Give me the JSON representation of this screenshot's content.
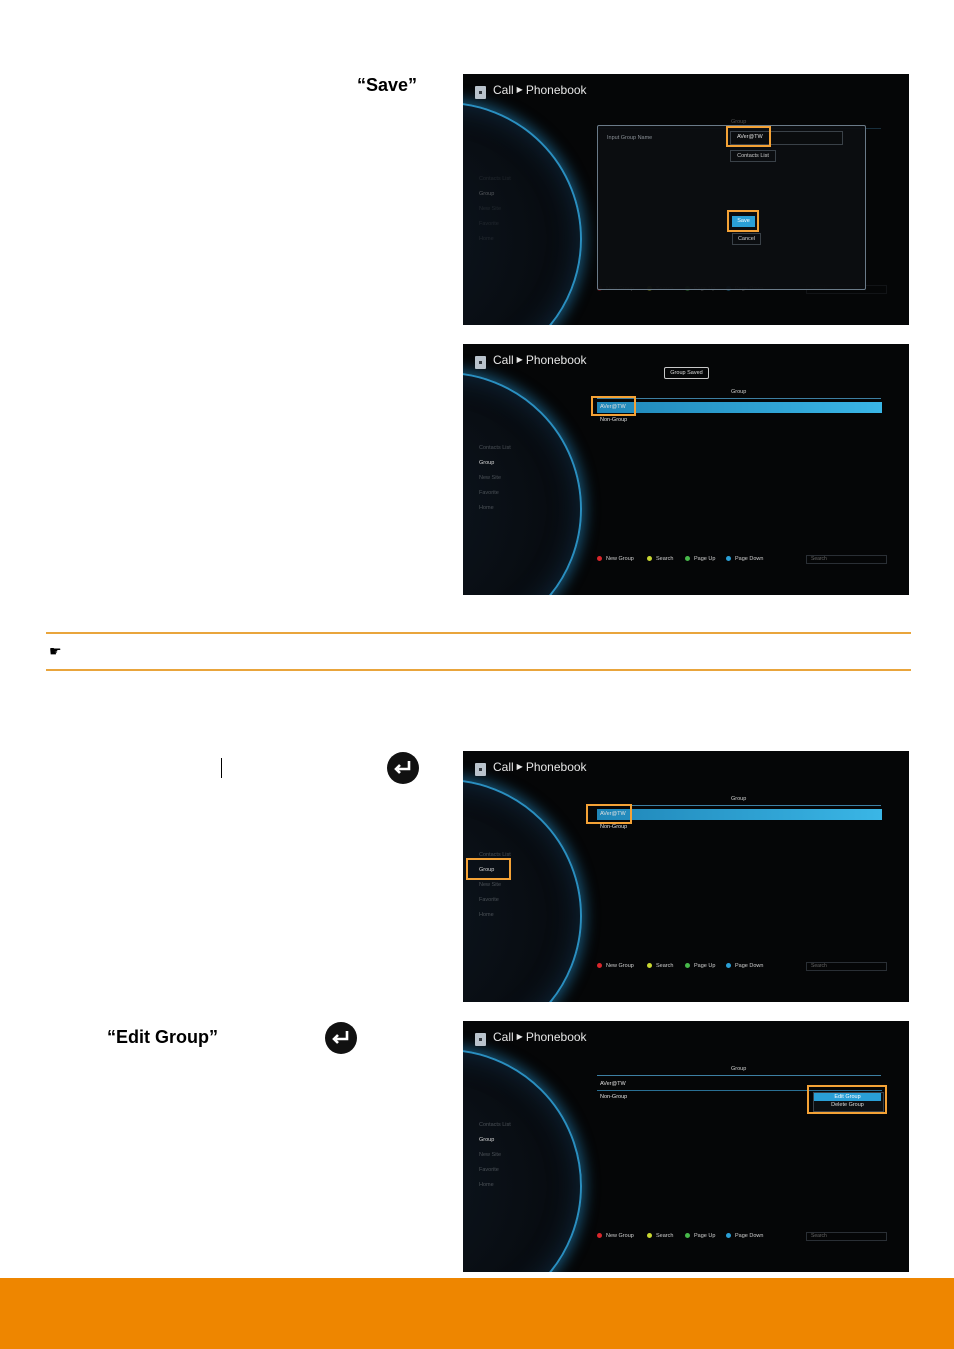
{
  "captions": {
    "save": "“Save”",
    "edit_group": "“Edit Group”"
  },
  "note": {
    "icon": "hand-pointing-icon"
  },
  "icons": {
    "enter": "enter-key-icon"
  },
  "colors": {
    "accent": "#ee8600",
    "highlight": "#f4a236",
    "rule": "#e9a53c",
    "screen_bg": "#050607",
    "selection": "#2a9fd6"
  },
  "ui": {
    "title": {
      "call": "Call",
      "phonebook": "Phonebook"
    },
    "sidebar": [
      "Contacts List",
      "Group",
      "New Site",
      "Favorite",
      "Home"
    ],
    "group_header": "Group",
    "rows": [
      "AVer@TW",
      "Non-Group"
    ],
    "legend": [
      {
        "label": "New Group",
        "color": "#d9262b"
      },
      {
        "label": "Search",
        "color": "#c8d632"
      },
      {
        "label": "Page Up",
        "color": "#47b94a"
      },
      {
        "label": "Page Down",
        "color": "#2a9fd6"
      }
    ],
    "search": "Search"
  },
  "dialog": {
    "input_label": "Input Group Name",
    "group_label": "Group",
    "name_value": "AVer@TW",
    "contacts_list_button": "Contacts List",
    "save_button": "Save",
    "cancel_button": "Cancel"
  },
  "toast": "Group Saved",
  "context_menu": [
    "Edit Group",
    "Delete Group"
  ]
}
